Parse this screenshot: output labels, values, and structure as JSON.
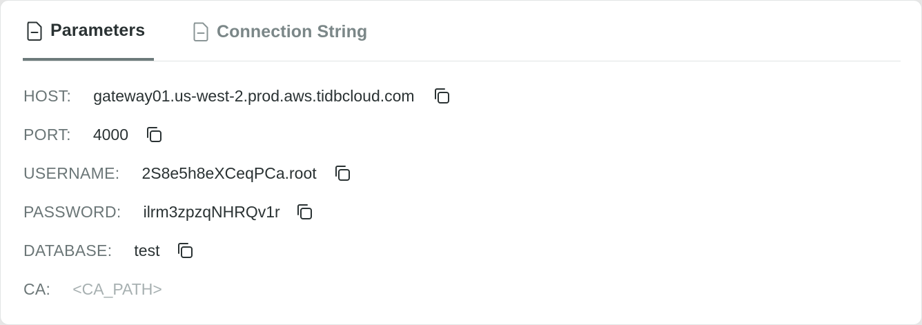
{
  "tabs": [
    {
      "label": "Parameters",
      "icon": "document-icon",
      "active": true
    },
    {
      "label": "Connection String",
      "icon": "document-icon",
      "active": false
    }
  ],
  "params": {
    "host": {
      "key": "HOST:",
      "value": "gateway01.us-west-2.prod.aws.tidbcloud.com",
      "copy_icon": "copy-icon"
    },
    "port": {
      "key": "PORT:",
      "value": "4000",
      "copy_icon": "copy-icon"
    },
    "username": {
      "key": "USERNAME:",
      "value": "2S8e5h8eXCeqPCa.root",
      "copy_icon": "copy-icon"
    },
    "password": {
      "key": "PASSWORD:",
      "value": "ilrm3zpzqNHRQv1r",
      "copy_icon": "copy-icon"
    },
    "database": {
      "key": "DATABASE:",
      "value": "test",
      "copy_icon": "copy-icon"
    },
    "ca": {
      "key": "CA:",
      "value": "<CA_PATH>"
    }
  },
  "colors": {
    "active_tab_text": "#2a3233",
    "inactive_tab_text": "#7b8788",
    "active_tab_underline": "#6d7a7b",
    "key_text": "#6b7677",
    "value_text": "#2a3233",
    "placeholder_text": "#a7b0b1"
  }
}
